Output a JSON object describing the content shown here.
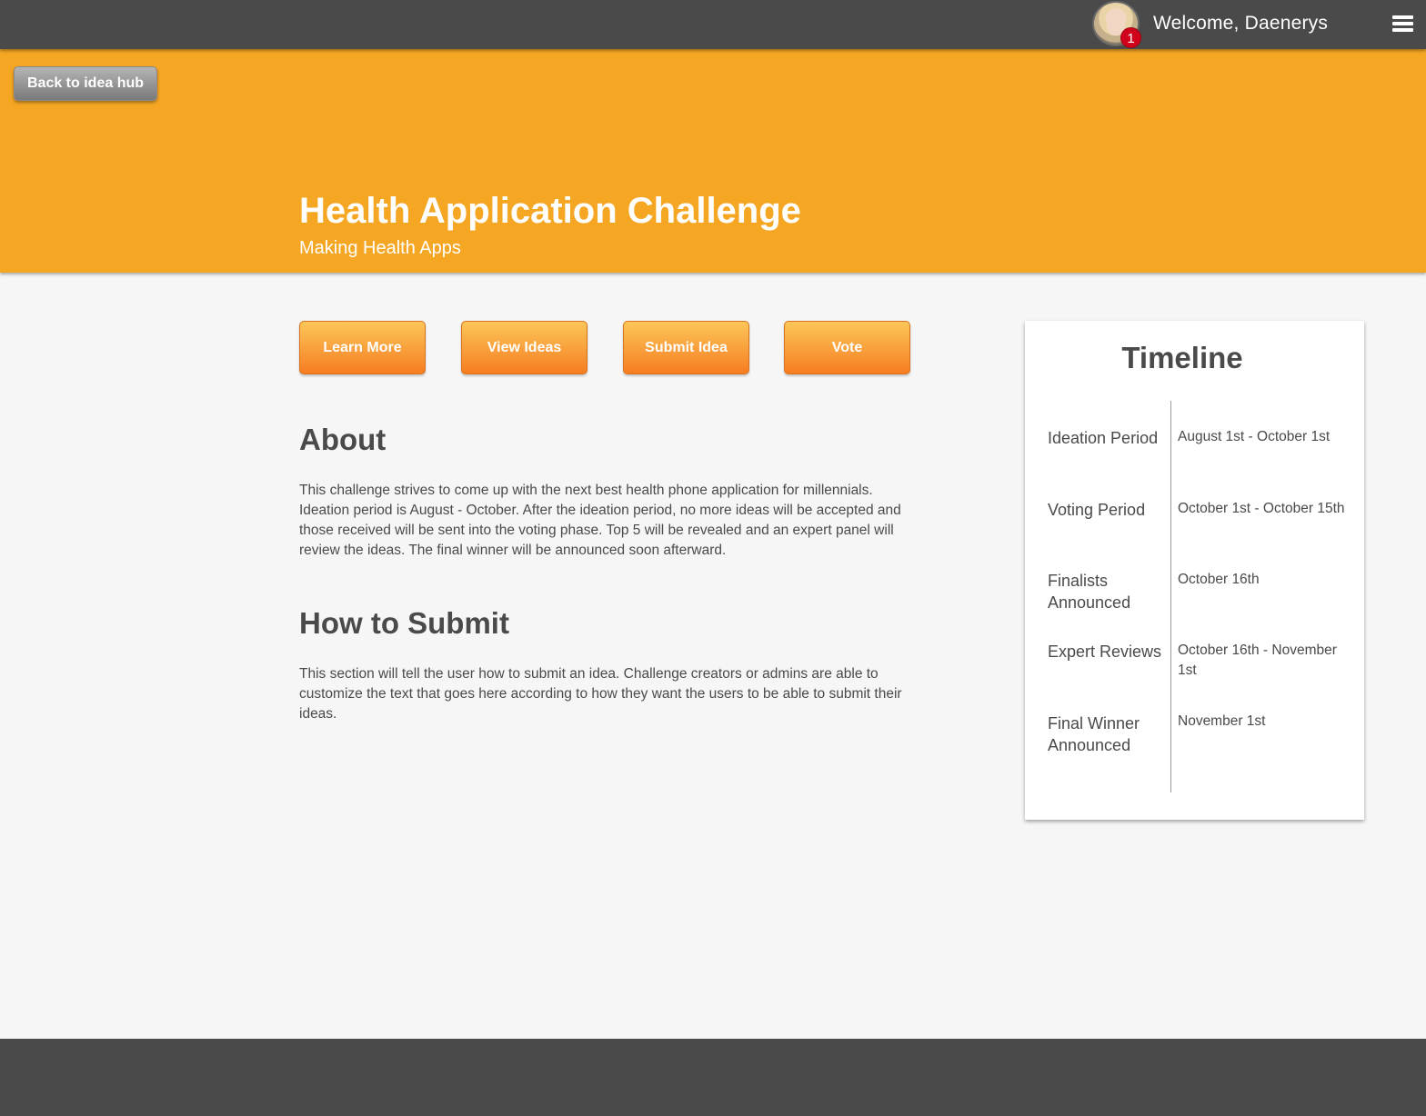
{
  "header": {
    "welcome_text": "Welcome, Daenerys",
    "notification_count": "1",
    "menu_icon": "hamburger-menu-icon"
  },
  "hero": {
    "back_label": "Back to idea hub",
    "title": "Health Application Challenge",
    "subtitle": "Making Health Apps"
  },
  "actions": [
    {
      "label": "Learn More"
    },
    {
      "label": "View Ideas"
    },
    {
      "label": "Submit Idea"
    },
    {
      "label": "Vote"
    }
  ],
  "about": {
    "heading": "About",
    "body": "This challenge strives to come up with the next best health phone application for millennials. Ideation period is August - October. After the ideation period, no more ideas will be accepted and those received will be sent into the voting phase. Top 5 will be revealed and an expert panel will review the ideas. The final winner will be announced soon afterward."
  },
  "how_to_submit": {
    "heading": "How to Submit",
    "body": "This section will tell the user how to submit an idea. Challenge creators or admins are able to customize the text that goes here according to how they want the users to be able to submit their ideas."
  },
  "timeline": {
    "title": "Timeline",
    "items": [
      {
        "label": "Ideation Period",
        "date": "August 1st - October 1st"
      },
      {
        "label": "Voting Period",
        "date": "October 1st - October 15th"
      },
      {
        "label": "Finalists Announced",
        "date": "October 16th"
      },
      {
        "label": "Expert Reviews",
        "date": "October 16th - November 1st"
      },
      {
        "label": "Final Winner Announced",
        "date": "November 1st"
      }
    ]
  },
  "colors": {
    "topbar": "#4a4a4a",
    "hero": "#f5a623",
    "button_top": "#fcc65a",
    "button_bottom": "#f67d21",
    "badge": "#d0021b",
    "page_bg": "#f6f6f6"
  }
}
